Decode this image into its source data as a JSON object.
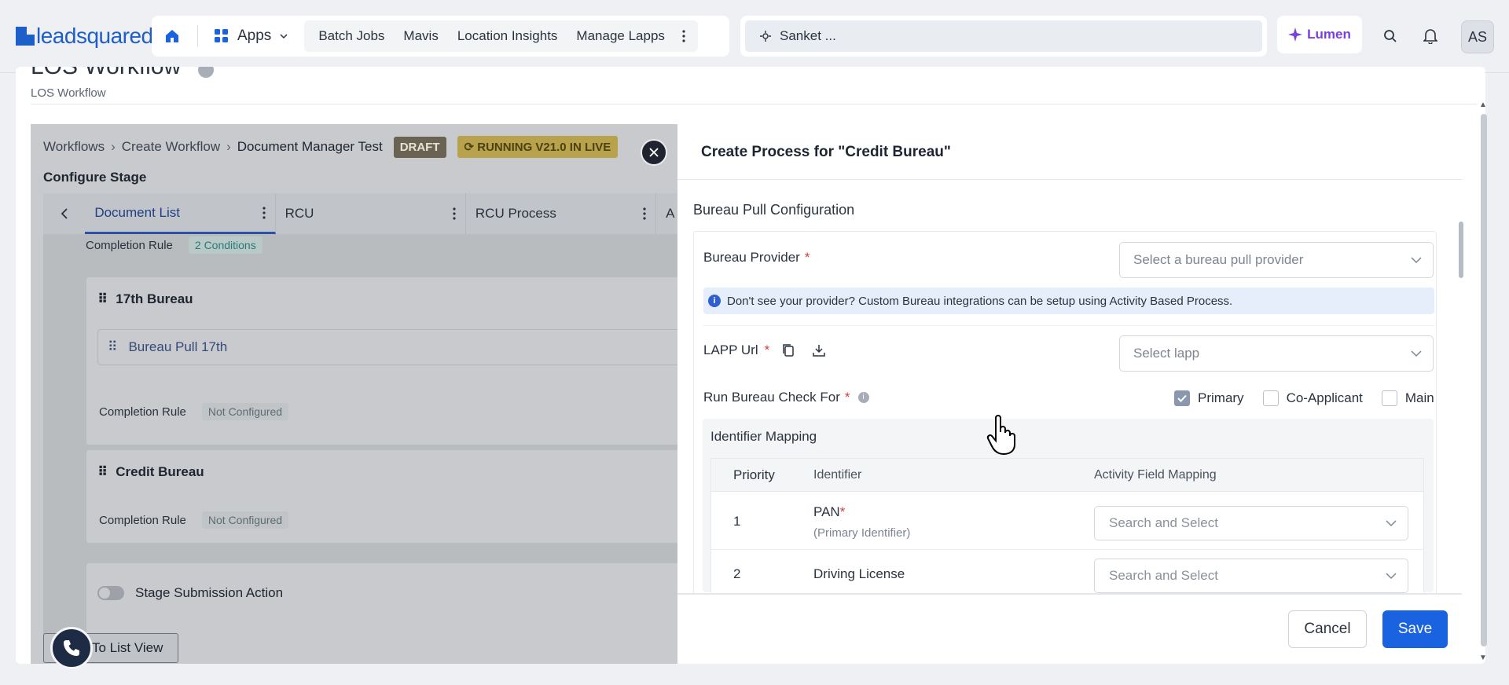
{
  "nav": {
    "logo_text": "leadsquared",
    "apps_label": "Apps",
    "links": [
      "Batch Jobs",
      "Mavis",
      "Location Insights",
      "Manage Lapps"
    ],
    "search_value": "Sanket ...",
    "lumen_label": "Lumen",
    "avatar_initials": "AS"
  },
  "page": {
    "title": "LOS Workflow",
    "subtitle": "LOS Workflow"
  },
  "workflow": {
    "breadcrumb": [
      "Workflows",
      "Create Workflow",
      "Document Manager Test"
    ],
    "draft_badge": "DRAFT",
    "running_badge": "RUNNING V21.0 IN LIVE",
    "configure_stage": "Configure Stage",
    "tabs": [
      "Document List",
      "RCU",
      "RCU Process"
    ],
    "tab_overflow": "A",
    "top_rule": {
      "label": "Completion Rule",
      "value": "2 Conditions"
    },
    "stages": [
      {
        "title": "17th Bureau",
        "subitem": "Bureau Pull 17th",
        "rule_label": "Completion Rule",
        "rule_value": "Not Configured"
      },
      {
        "title": "Credit Bureau",
        "rule_label": "Completion Rule",
        "rule_value": "Not Configured"
      }
    ],
    "stage_submission": "Stage Submission Action",
    "list_view_button": "To List View"
  },
  "drawer": {
    "title": "Create Process for \"Credit Bureau\"",
    "section": "Bureau Pull Configuration",
    "bureau_provider_label": "Bureau Provider",
    "bureau_provider_placeholder": "Select a bureau pull provider",
    "info_text": "Don't see your provider? Custom Bureau integrations can be setup using Activity Based Process.",
    "lapp_url_label": "LAPP Url",
    "lapp_placeholder": "Select lapp",
    "run_check_label": "Run Bureau Check For",
    "checks": [
      {
        "label": "Primary",
        "checked": true
      },
      {
        "label": "Co-Applicant",
        "checked": false
      },
      {
        "label": "Main",
        "checked": false
      }
    ],
    "identifier_mapping": "Identifier Mapping",
    "table": {
      "headers": [
        "Priority",
        "Identifier",
        "Activity Field Mapping"
      ],
      "rows": [
        {
          "priority": "1",
          "identifier": "PAN",
          "sub": "(Primary Identifier)",
          "required": true,
          "placeholder": "Search and Select"
        },
        {
          "priority": "2",
          "identifier": "Driving License",
          "sub": "",
          "required": false,
          "placeholder": "Search and Select"
        }
      ]
    },
    "cancel_label": "Cancel",
    "save_label": "Save"
  },
  "colors": {
    "brand": "#1d5ec9",
    "primary_button": "#1a63e0",
    "lumen": "#7a3fe0",
    "required": "#d93b3b"
  }
}
